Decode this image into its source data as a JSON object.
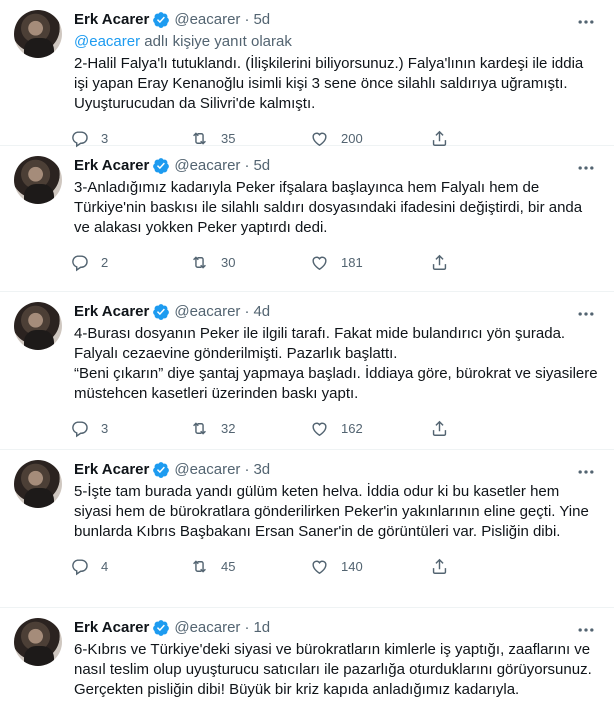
{
  "tweets": [
    {
      "name": "Erk Acarer",
      "handle": "@eacarer",
      "sep": "·",
      "time": "5d",
      "reply_to": {
        "mention": "@eacarer",
        "suffix": " adlı kişiye yanıt olarak"
      },
      "text": "2-Halil Falya'lı tutuklandı. (İlişkilerini biliyorsunuz.) Falya'lının kardeşi ile iddia işi yapan Eray Kenanoğlu isimli kişi 3 sene önce silahlı saldırıya uğramıştı. Uyuşturucudan da Silivri'de kalmıştı.",
      "replies": "3",
      "retweets": "35",
      "likes": "200"
    },
    {
      "name": "Erk Acarer",
      "handle": "@eacarer",
      "sep": "·",
      "time": "5d",
      "text": "3-Anladığımız kadarıyla Peker ifşalara başlayınca hem Falyalı hem de Türkiye'nin baskısı ile silahlı saldırı dosyasındaki ifadesini değiştirdi, bir anda ve alakası yokken Peker yaptırdı dedi.",
      "replies": "2",
      "retweets": "30",
      "likes": "181"
    },
    {
      "name": "Erk Acarer",
      "handle": "@eacarer",
      "sep": "·",
      "time": "4d",
      "text": "4-Burası dosyanın Peker ile ilgili tarafı. Fakat mide bulandırıcı yön şurada. Falyalı cezaevine gönderilmişti. Pazarlık başlattı.\n“Beni çıkarın” diye şantaj yapmaya başladı. İddiaya göre, bürokrat ve siyasilere müstehcen kasetleri üzerinden baskı yaptı.",
      "replies": "3",
      "retweets": "32",
      "likes": "162"
    },
    {
      "name": "Erk Acarer",
      "handle": "@eacarer",
      "sep": "·",
      "time": "3d",
      "text": "5-İşte tam burada yandı gülüm keten helva. İddia odur ki bu kasetler hem siyasi hem de bürokratlara gönderilirken Peker'in yakınlarının eline geçti. Yine bunlarda Kıbrıs Başbakanı Ersan Saner'in de görüntüleri var. Pisliğin dibi.",
      "replies": "4",
      "retweets": "45",
      "likes": "140"
    },
    {
      "name": "Erk Acarer",
      "handle": "@eacarer",
      "sep": "·",
      "time": "1d",
      "text": "6-Kıbrıs ve Türkiye'deki siyasi ve bürokratların kimlerle iş yaptığı, zaaflarını ve nasıl teslim olup uyuşturucu satıcıları ile pazarlığa oturduklarını görüyorsunuz. Gerçekten pisliğin dibi! Büyük bir kriz kapıda anladığımız kadarıyla."
    }
  ],
  "colors": {
    "accent": "#1d9bf0",
    "muted": "#536471",
    "text": "#0f1419",
    "border": "#eff3f4"
  }
}
